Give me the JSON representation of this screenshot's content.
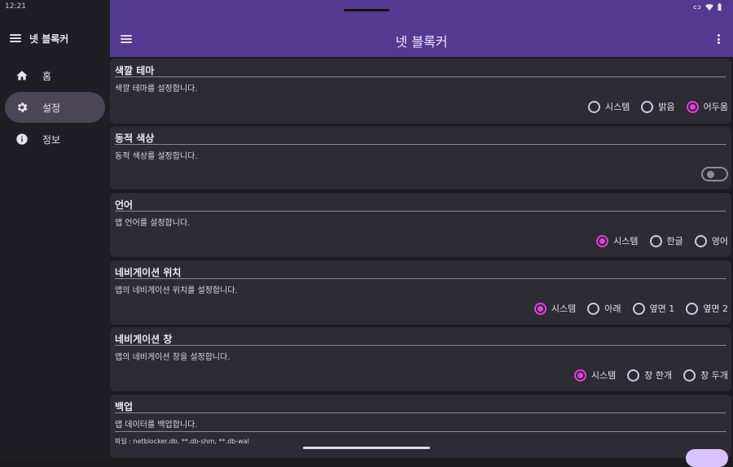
{
  "status_bar": {
    "time": "12:21"
  },
  "sidebar": {
    "title": "넷 블록커",
    "items": [
      {
        "label": "홈",
        "icon": "home-icon"
      },
      {
        "label": "설정",
        "icon": "gear-icon",
        "active": true
      },
      {
        "label": "정보",
        "icon": "info-icon"
      }
    ]
  },
  "appbar": {
    "title": "넷 블록커"
  },
  "sections": {
    "theme": {
      "title": "색깔 테마",
      "desc": "색깔 테마를 설정합니다.",
      "options": [
        "시스템",
        "밝음",
        "어두움"
      ],
      "selected": "어두움"
    },
    "dynamic": {
      "title": "동적 색상",
      "desc": "동적 색상를 설정합니다.",
      "enabled": false
    },
    "language": {
      "title": "언어",
      "desc": "앱 언어를 설정합니다.",
      "options": [
        "시스템",
        "한글",
        "영어"
      ],
      "selected": "시스템"
    },
    "nav_position": {
      "title": "네비게이션 위치",
      "desc": "앱의 네비게이션 위치를 설정합니다.",
      "options": [
        "시스템",
        "아래",
        "옆면 1",
        "옆면 2"
      ],
      "selected": "시스템"
    },
    "nav_window": {
      "title": "네비게이션 창",
      "desc": "앱의 네비게이션 창을 설정합니다.",
      "options": [
        "시스템",
        "창 한개",
        "창 두개"
      ],
      "selected": "시스템"
    },
    "backup": {
      "title": "백업",
      "desc": "앱 데이터를 백업합니다.",
      "files": "파일 : netblocker.db, **.db-shm, **.db-wal"
    }
  },
  "colors": {
    "appbar": "#533a91",
    "accent": "#e23fe0",
    "active_nav": "#4a4658"
  }
}
